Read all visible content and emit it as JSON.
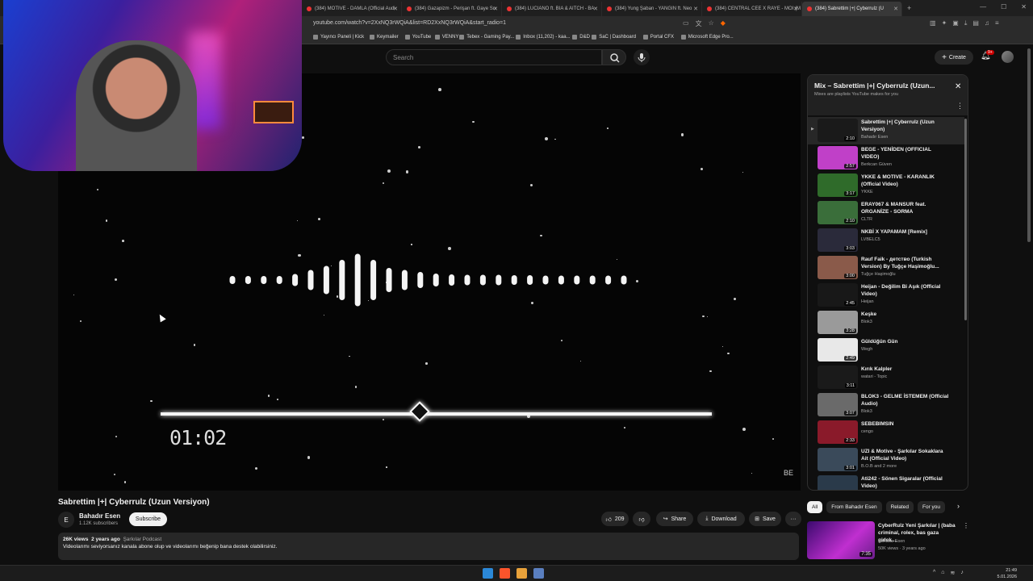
{
  "browser": {
    "tabs": [
      {
        "label": "(384) MOTIVE - DAMLA (Official Audi",
        "active": false
      },
      {
        "label": "(384) Gazapizm - Perişan ft. Gaye Su",
        "active": false
      },
      {
        "label": "(384) LUCIANO ft. BIA & AITCH - BA",
        "active": false
      },
      {
        "label": "(384) Yung Şaban - YANGIN ft. Neo",
        "active": false
      },
      {
        "label": "(384) CENTRAL CEE X RAYE - MOI (M",
        "active": false
      },
      {
        "label": "(384) Sabrettim |+| Cyberrulz (U",
        "active": true
      }
    ],
    "new_tab": "+",
    "url": "youtube.com/watch?v=2XxNQ3rWQiA&list=RD2XxNQ3rWQiA&start_radio=1",
    "bookmarks": [
      "Yayıncı Paneli | Kick",
      "Keymailer",
      "YouTube",
      "VENNY",
      "Tebex - Gaming Pay...",
      "Inbox (11,202) - kaa...",
      "D&D",
      "SaC | Dashboard",
      "Portal CFX",
      "Microsoft Edge Pro..."
    ]
  },
  "header": {
    "search_placeholder": "Search",
    "create_label": "Create",
    "notif_count": "9+"
  },
  "video": {
    "timestamp": "01:02",
    "watermark": "BE",
    "progress": 0.47
  },
  "info": {
    "title": "Sabrettim |+| Cyberrulz (Uzun Versiyon)",
    "channel": "Bahadır Esen",
    "channel_initial": "E",
    "subscribers": "1.12K subscribers",
    "subscribe_label": "Subscribe",
    "likes": "209",
    "share_label": "Share",
    "download_label": "Download",
    "save_label": "Save",
    "more": "···",
    "views": "26K views",
    "age": "2 years ago",
    "tag": "Şarkılar Podcast",
    "description": "Videolarımı seviyorsanız kanala abone olup ve videolarımı beğenip bana destek olabilirsiniz."
  },
  "playlist": {
    "title": "Mix – Sabrettim |+| Cyberrulz (Uzun...",
    "subtitle": "Mixes are playlists YouTube makes for you",
    "items": [
      {
        "name": "Sabrettim |+| Cyberrulz (Uzun Versiyon)",
        "channel": "Bahadır Esen",
        "duration": "2:10",
        "color": "#1a1a1a",
        "active": true
      },
      {
        "name": "BEGE - YENİDEN (OFFICIAL VIDEO)",
        "channel": "Berkcan Güven",
        "duration": "2:57",
        "color": "#c040c8",
        "active": false
      },
      {
        "name": "YKKE & MOTIVE - KARANLIK (Official Video)",
        "channel": "YKKE",
        "duration": "3:17",
        "color": "#2f6b2a",
        "active": false
      },
      {
        "name": "ERAY067 & MANSUR feat. ORGANİZE - SORMA",
        "channel": "CLTR",
        "duration": "2:10",
        "color": "#3a6e3a",
        "active": false
      },
      {
        "name": "NKBİ X YAPAMAM [Remix]",
        "channel": "LVBELC5",
        "duration": "3:03",
        "color": "#2a2a3a",
        "active": false
      },
      {
        "name": "Rauf Faik - детство (Turkish Version) By Tuğçe Haşimoğlu...",
        "channel": "Tuğçe Haşimoğlu",
        "duration": "3:00",
        "color": "#8a5a4a",
        "active": false
      },
      {
        "name": "Heijan - Değilim Bi Aşık (Official Video)",
        "channel": "Heijan",
        "duration": "2:45",
        "color": "#181818",
        "active": false
      },
      {
        "name": "Keşke",
        "channel": "Blok3",
        "duration": "3:28",
        "color": "#9a9a9a",
        "active": false
      },
      {
        "name": "Güldüğün Gün",
        "channel": "Wegh",
        "duration": "2:49",
        "color": "#e8e8e8",
        "active": false
      },
      {
        "name": "Kırık Kalpler",
        "channel": "watari - Topic",
        "duration": "3:11",
        "color": "#1a1a1a",
        "active": false
      },
      {
        "name": "BLOK3 - GELME İSTEMEM (Official Audio)",
        "channel": "Blok3",
        "duration": "3:07",
        "color": "#6a6a6a",
        "active": false
      },
      {
        "name": "SEBEBIMSIN",
        "channel": "cengo",
        "duration": "2:33",
        "color": "#8a1a2a",
        "active": false
      },
      {
        "name": "UZI & Motive - Şarkılar Sokaklara Ait (Official Video)",
        "channel": "B.O.B and 2 more",
        "duration": "3:01",
        "color": "#3a4a5a",
        "active": false
      },
      {
        "name": "Ati242 - Sönen Sigaralar (Official Video)",
        "channel": "",
        "duration": "3:30",
        "color": "#2a3a4a",
        "active": false
      }
    ]
  },
  "chips": [
    "All",
    "From Bahadır Esen",
    "Related",
    "For you"
  ],
  "recommendation": {
    "title": "CyberRulz Yeni Şarkılar | (baba criminal, rolex, bas gaza gidek,...",
    "channel": "Bahadır Esen",
    "meta": "50K views · 3 years ago",
    "duration": "7:35"
  },
  "taskbar": {
    "time": "21:49",
    "date": "5.01.2026"
  }
}
